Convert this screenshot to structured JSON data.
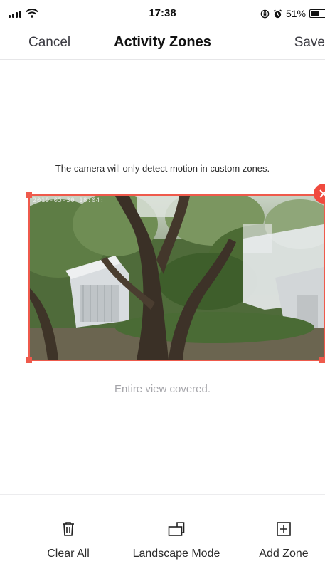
{
  "status_bar": {
    "time": "17:38",
    "battery": "51%",
    "battery_level": 0.51,
    "icons": [
      "signal-icon",
      "wifi-icon",
      "orientation-lock-icon",
      "alarm-icon",
      "battery-icon"
    ]
  },
  "nav": {
    "cancel": "Cancel",
    "title": "Activity Zones",
    "save": "Save"
  },
  "hint": "The camera will only detect motion in custom zones.",
  "camera": {
    "timestamp": "2019-05-30 18:04:"
  },
  "zone": {
    "color": "#ef5a4c",
    "remove_icon": "close-icon"
  },
  "coverage_text": "Entire view covered.",
  "toolbar": {
    "clear_all": "Clear All",
    "landscape_mode": "Landscape Mode",
    "add_zone": "Add Zone",
    "icons": [
      "trash-icon",
      "landscape-icon",
      "add-box-icon"
    ]
  }
}
